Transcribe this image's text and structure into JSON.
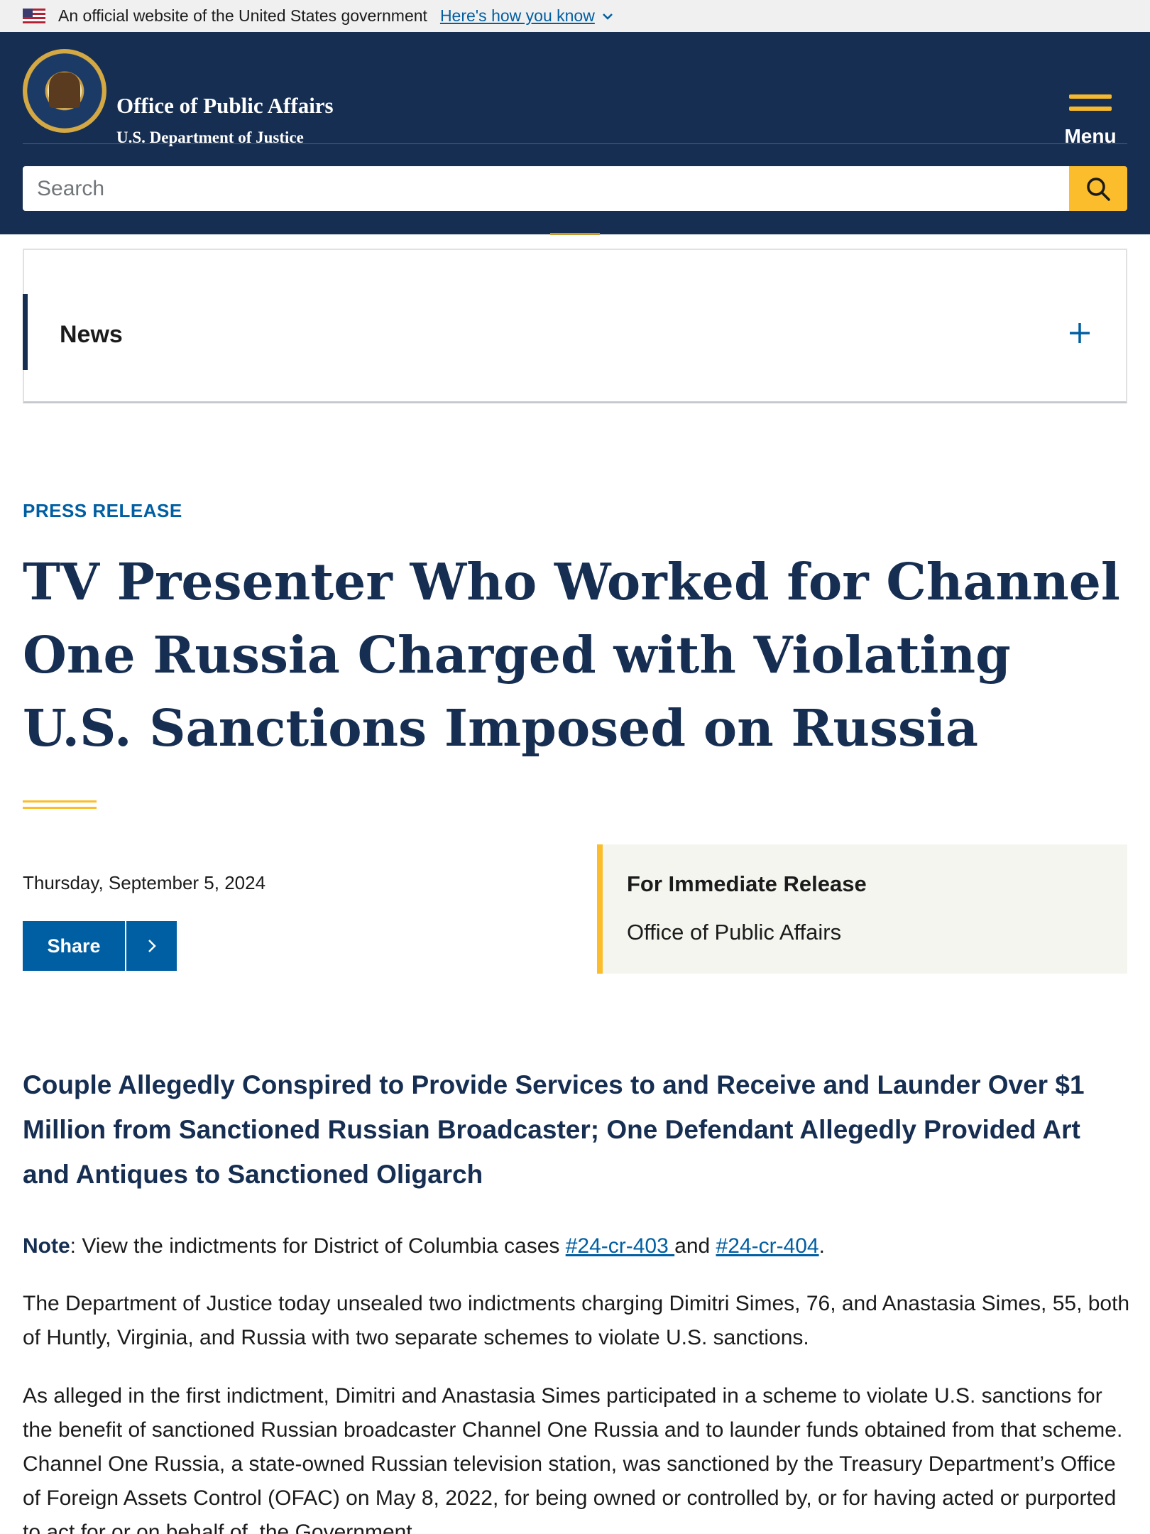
{
  "gov_banner": {
    "text": "An official website of the United States government",
    "link": "Here's how you know"
  },
  "header": {
    "title": "Office of Public Affairs",
    "subtitle": "U.S. Department of Justice",
    "menu_label": "Menu",
    "search_placeholder": "Search"
  },
  "nav": {
    "section_label": "News"
  },
  "article": {
    "eyebrow": "PRESS RELEASE",
    "title": "TV Presenter Who Worked for Channel One Russia Charged with Violating U.S. Sanctions Imposed on Russia",
    "date": "Thursday, September 5, 2024",
    "share_label": "Share",
    "release_title": "For Immediate Release",
    "release_office": "Office of Public Affairs",
    "subtitle": "Couple Allegedly Conspired to Provide Services to and Receive and Launder Over $1 Million from Sanctioned Russian Broadcaster; One Defendant Allegedly Provided Art and Antiques to Sanctioned Oligarch",
    "note": {
      "label": "Note",
      "text_before": ": View the indictments for District of Columbia cases ",
      "link1": "#24-cr-403 ",
      "text_between": "and ",
      "link2": "#24-cr-404",
      "text_after": "."
    },
    "paragraph1": "The Department of Justice today unsealed two indictments charging Dimitri Simes, 76, and Anastasia Simes, 55, both of Huntly, Virginia, and Russia with two separate schemes to violate U.S. sanctions.",
    "paragraph2": "As alleged in the first indictment, Dimitri and Anastasia Simes participated in a scheme to violate U.S. sanctions for the benefit of sanctioned Russian broadcaster Channel One Russia and to launder funds obtained from that scheme. Channel One Russia, a state-owned Russian television station, was sanctioned by the Treasury Department’s Office of Foreign Assets Control (OFAC) on May 8, 2022, for being owned or controlled by, or for having acted or purported to act for or on behalf of, the Government"
  },
  "colors": {
    "navy": "#162e51",
    "gold": "#fbbd2b",
    "link_blue": "#005ea2"
  }
}
